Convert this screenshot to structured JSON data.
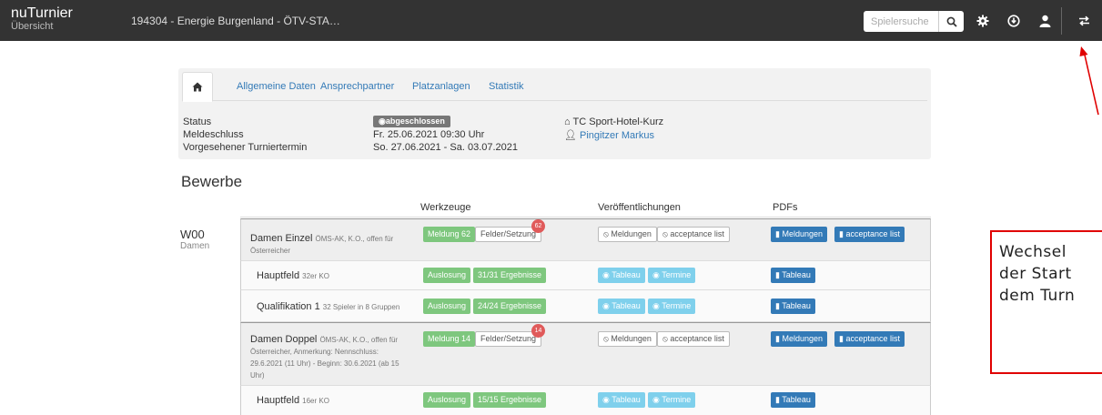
{
  "header": {
    "brand": "nuTurnier",
    "brand_sub": "Übersicht",
    "tournament": "194304 - Energie Burgenland - ÖTV-STA…",
    "search_placeholder": "Spielersuche",
    "icons": [
      "search-icon",
      "gear-icon",
      "download-icon",
      "user-icon",
      "swap-icon"
    ]
  },
  "tabs": [
    "Allgemeine Daten",
    "Ansprechpartner",
    "Platzanlagen",
    "Statistik"
  ],
  "info": {
    "status_label": "Status",
    "status_value": "abgeschlossen",
    "deadline_label": "Meldeschluss",
    "deadline_value": "Fr. 25.06.2021 09:30 Uhr",
    "date_label": "Vorgesehener Turniertermin",
    "date_value": "So. 27.06.2021 - Sa. 03.07.2021",
    "club": "TC Sport-Hotel-Kurz",
    "contact": "Pingitzer Markus"
  },
  "section_title": "Bewerbe",
  "columns": [
    "Werkzeuge",
    "Veröffentlichungen",
    "PDFs"
  ],
  "group": {
    "code": "W00",
    "name": "Damen"
  },
  "rows": [
    {
      "title": "Damen Einzel",
      "desc": "ÖMS-AK, K.O., offen für Österreicher",
      "tool1": "Meldung 62",
      "tool2": "Felder/Setzung",
      "tool_badge": "62",
      "pub1": "Meldungen",
      "pub2": "acceptance list",
      "pdf1": "Meldungen",
      "pdf2": "acceptance list"
    },
    {
      "title": "Hauptfeld",
      "desc": "32er KO",
      "tool1": "Auslosung",
      "tool2": "31/31 Ergebnisse",
      "pub1": "Tableau",
      "pub2": "Termine",
      "pdf1": "Tableau"
    },
    {
      "title": "Qualifikation 1",
      "desc": "32 Spieler in 8 Gruppen",
      "tool1": "Auslosung",
      "tool2": "24/24 Ergebnisse",
      "pub1": "Tableau",
      "pub2": "Termine",
      "pdf1": "Tableau"
    },
    {
      "title": "Damen Doppel",
      "desc": "ÖMS-AK, K.O., offen für Österreicher, Anmerkung: Nennschluss: 29.6.2021 (11 Uhr) - Beginn: 30.6.2021 (ab 15 Uhr)",
      "tool1": "Meldung 14",
      "tool2": "Felder/Setzung",
      "tool_badge": "14",
      "pub1": "Meldungen",
      "pub2": "acceptance list",
      "pdf1": "Meldungen",
      "pdf2": "acceptance list"
    },
    {
      "title": "Hauptfeld",
      "desc": "16er KO",
      "tool1": "Auslosung",
      "tool2": "15/15 Ergebnisse",
      "pub1": "Tableau",
      "pub2": "Termine",
      "pdf1": "Tableau"
    }
  ],
  "annotation": {
    "line1": "Wechsel",
    "line2": "der Start",
    "line3": "dem Turn"
  },
  "colors": {
    "topbar": "#333333",
    "link": "#337ab7",
    "green": "#7ec77e",
    "light_blue": "#7fd0ec",
    "badge_red": "#e05a5a",
    "annotation_red": "#e00000"
  }
}
